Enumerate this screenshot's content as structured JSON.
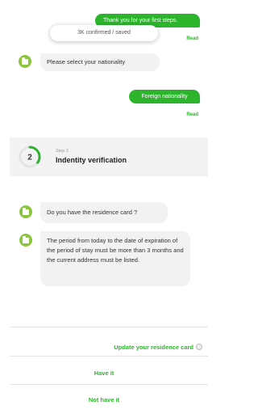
{
  "chat": {
    "msg1": {
      "text": "Thank you for your first steps.",
      "status": "Read"
    },
    "toast": "3K confirmed / saved",
    "bot1": "Please select your nationality",
    "msg2": {
      "text": "Foreign nationality",
      "status": "Read"
    },
    "step": {
      "small": "Step 2",
      "title": "Indentity verification",
      "number": "2",
      "progress": 0.35
    },
    "bot2": "Do you have the residence card ?",
    "bot3": "The period from today to the date of expiration of the period of stay must be more than 3 months and the current address must be listed."
  },
  "options": {
    "header": "Update your residence card",
    "have": "Have it",
    "not_have": "Not have it"
  },
  "colors": {
    "accent": "#2cb52c",
    "bot_icon": "#8cc63f"
  }
}
